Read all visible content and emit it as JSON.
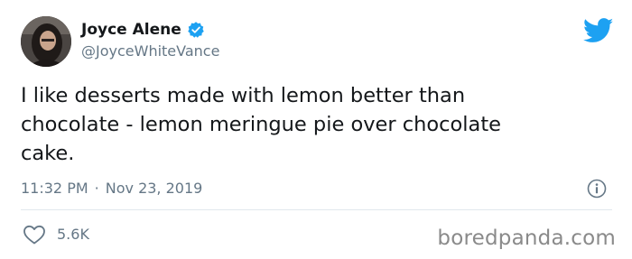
{
  "tweet": {
    "author": {
      "name": "Joyce Alene",
      "handle": "@JoyceWhiteVance",
      "verified": true
    },
    "text": "I like desserts made with lemon better than\nchocolate - lemon meringue pie over chocolate\ncake.",
    "time": "11:32 PM",
    "separator": "·",
    "date": "Nov 23, 2019",
    "likes": "5.6K"
  },
  "icons": {
    "verified": "verified-badge-icon",
    "twitter": "twitter-bird-icon",
    "info": "info-icon",
    "heart": "heart-icon"
  },
  "colors": {
    "twitter_blue": "#1da1f2",
    "secondary_text": "#657786",
    "primary_text": "#14171a",
    "divider": "#e1e8ed"
  },
  "watermark": "boredpanda.com"
}
